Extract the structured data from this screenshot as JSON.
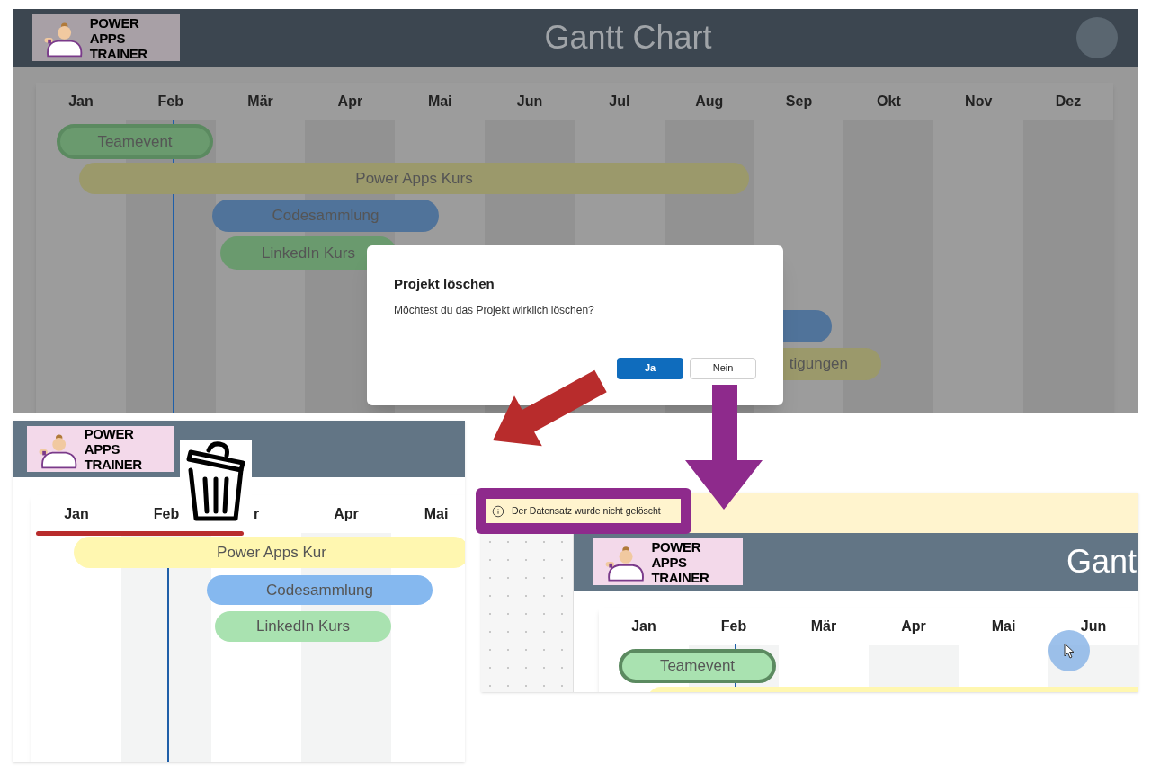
{
  "main_screen": {
    "logo": {
      "text": "POWER APPS TRAINER"
    },
    "title": "Gantt Chart",
    "months": [
      "Jan",
      "Feb",
      "Mär",
      "Apr",
      "Mai",
      "Jun",
      "Jul",
      "Aug",
      "Sep",
      "Okt",
      "Nov",
      "Dez"
    ],
    "bars": [
      {
        "label": "Teamevent",
        "color": "#6a9a6e",
        "selected": true
      },
      {
        "label": "Power Apps Kurs",
        "color": "#9b996b",
        "selected": false
      },
      {
        "label": "Codesammlung",
        "color": "#50739a",
        "selected": false
      },
      {
        "label": "LinkedIn Kurs",
        "color": "#6a9a6e",
        "selected": false
      },
      {
        "color": "#50739a",
        "selected": false
      },
      {
        "label": "tigungen",
        "color": "#9b996b",
        "selected": false
      }
    ],
    "dialog": {
      "title": "Projekt löschen",
      "message": "Möchtest du das Projekt wirklich löschen?",
      "buttons": [
        {
          "label": "Ja",
          "kind": "primary"
        },
        {
          "label": "Nein",
          "kind": "secondary"
        }
      ]
    }
  },
  "delete_screen": {
    "logo": {
      "text": "POWER APPS TRAINER"
    },
    "months": [
      "Jan",
      "Feb",
      "r",
      "Apr",
      "Mai"
    ],
    "bars": [
      {
        "label": "Power Apps Kur",
        "color": "#fff7b0",
        "selected": false
      },
      {
        "label": "Codesammlung",
        "color": "#85b8ef",
        "selected": false
      },
      {
        "label": "LinkedIn Kurs",
        "color": "#a9e2b0",
        "selected": false
      }
    ]
  },
  "cancel_screen": {
    "notification": {
      "text": "Der Datensatz wurde nicht gelöscht"
    },
    "logo": {
      "text": "POWER APPS TRAINER"
    },
    "title": "Gant",
    "months": [
      "Jan",
      "Feb",
      "Mär",
      "Apr",
      "Mai",
      "Jun"
    ],
    "bars": [
      {
        "label": "Teamevent",
        "color": "#a9e2b0",
        "selected": true
      },
      {
        "color": "#fff7b0",
        "selected": false
      }
    ]
  }
}
